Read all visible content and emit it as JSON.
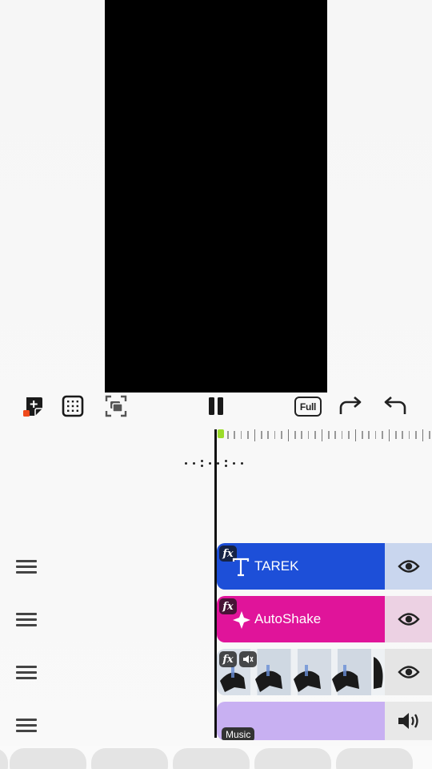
{
  "toolbar": {
    "full_label": "Full",
    "icons": [
      "add-sticker-icon",
      "grid-icon",
      "crop-frame-icon",
      "pause-icon",
      "redo-icon",
      "undo-icon"
    ]
  },
  "layers": [
    {
      "type": "text",
      "label": "TAREK",
      "fx": "fx",
      "color": "#1d4fd8",
      "toggle": "eye-icon"
    },
    {
      "type": "effect",
      "label": "AutoShake",
      "fx": "fx",
      "color": "#e0149a",
      "toggle": "eye-icon"
    },
    {
      "type": "video",
      "label": "",
      "fx": "fx",
      "toggle": "eye-icon"
    },
    {
      "type": "audio",
      "label": "Music",
      "color": "#c8b0f2",
      "toggle": "speaker-icon"
    }
  ],
  "colors": {
    "playhead_marker": "#9bdc2a",
    "preview": "#000000"
  }
}
